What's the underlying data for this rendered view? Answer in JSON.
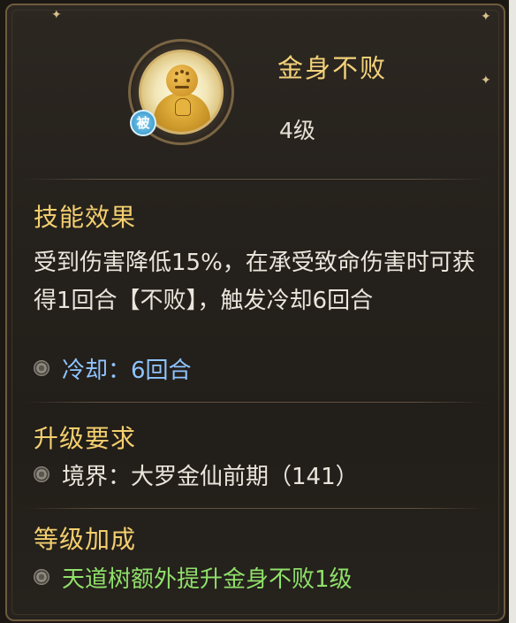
{
  "skill": {
    "name": "金身不败",
    "level": "4级",
    "badge": "被",
    "icon": "golden-monk-icon"
  },
  "sections": {
    "effect": {
      "title": "技能效果",
      "description": "受到伤害降低15%，在承受致命伤害时可获得1回合【不败】，触发冷却6回合",
      "cooldown": "冷却：6回合"
    },
    "upgrade": {
      "title": "升级要求",
      "requirement": "境界：大罗金仙前期（141）"
    },
    "bonus": {
      "title": "等级加成",
      "text": "天道树额外提升金身不败1级"
    }
  },
  "colors": {
    "title_gold": "#f3cf6f",
    "cooldown_blue": "#8fc4ff",
    "bonus_green": "#8fe06a",
    "body_text": "#eae6dc"
  }
}
